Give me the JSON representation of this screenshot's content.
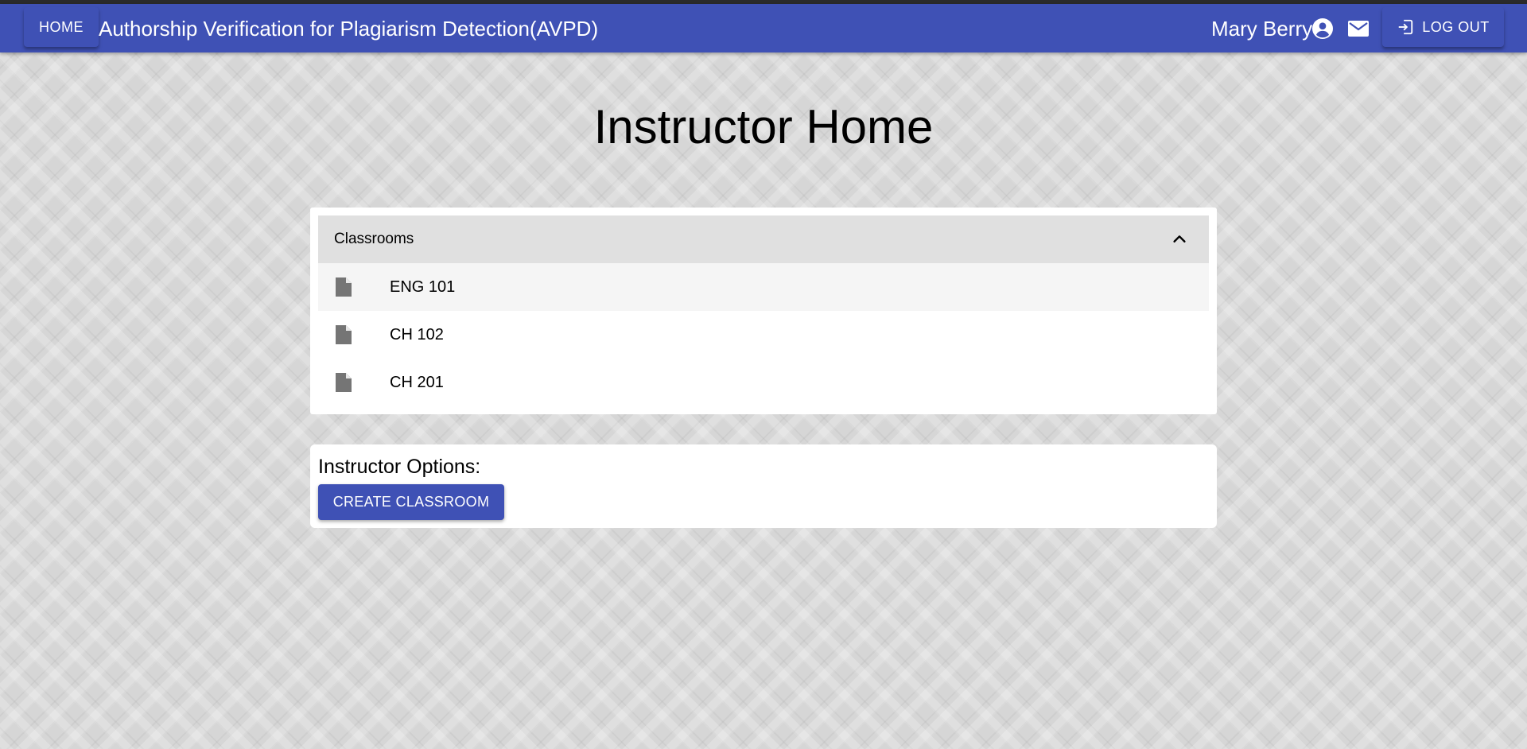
{
  "appbar": {
    "home_label": "HOME",
    "title": "Authorship Verification for Plagiarism Detection(AVPD)",
    "user_name": "Mary Berry",
    "logout_label": "LOG OUT",
    "color": "#3f51b5"
  },
  "page": {
    "title": "Instructor Home"
  },
  "classrooms": {
    "header": "Classrooms",
    "expanded": true,
    "items": [
      {
        "label": "ENG 101",
        "icon": "document-icon"
      },
      {
        "label": "CH 102",
        "icon": "document-icon"
      },
      {
        "label": "CH 201",
        "icon": "document-icon"
      }
    ]
  },
  "options": {
    "heading": "Instructor Options:",
    "create_label": "CREATE CLASSROOM"
  }
}
